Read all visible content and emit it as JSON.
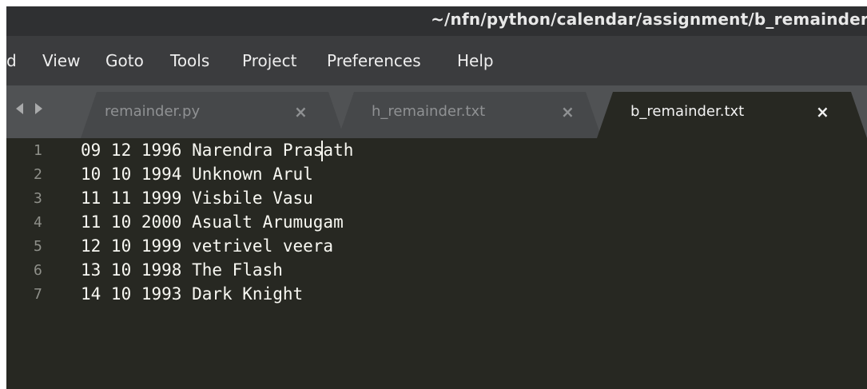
{
  "window": {
    "title": "~/nfn/python/calendar/assignment/b_remainder"
  },
  "menu": [
    "d",
    "View",
    "Goto",
    "Tools",
    "Project",
    "Preferences",
    "Help"
  ],
  "tabs": [
    {
      "label": "remainder.py",
      "close": "×",
      "active": false
    },
    {
      "label": "h_remainder.txt",
      "close": "×",
      "active": false
    },
    {
      "label": "b_remainder.txt",
      "close": "×",
      "active": true
    }
  ],
  "editor": {
    "line_numbers": [
      "1",
      "2",
      "3",
      "4",
      "5",
      "6",
      "7"
    ],
    "lines": [
      "09 12 1996 Narendra Prasath",
      "10 10 1994 Unknown Arul",
      "11 11 1999 Visbile Vasu",
      "11 10 2000 Asualt Arumugam",
      "12 10 1999 vetrivel veera",
      "13 10 1998 The Flash",
      "14 10 1993 Dark Knight"
    ],
    "cursor": {
      "line": 1,
      "column": 20
    }
  },
  "colors": {
    "editor_background": "#272822",
    "tabbar_background": "#505254",
    "active_tab": "#272822",
    "inactive_tab": "#46484a",
    "menubar_background": "#3b3c3e",
    "titlebar_background": "#2f3032",
    "text": "#f8f8f2",
    "line_number": "#8f908a"
  }
}
